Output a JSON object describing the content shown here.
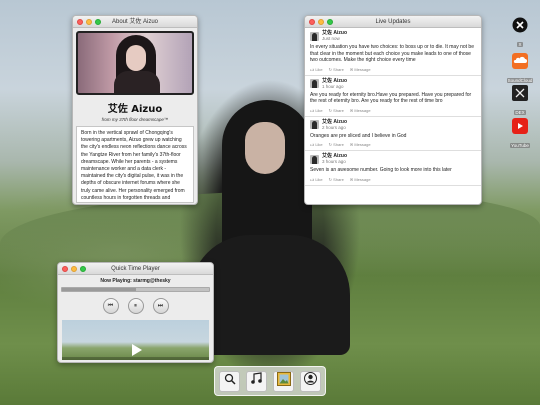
{
  "about": {
    "window_title": "About 艾佐 Aizuo",
    "name": "艾佐 Aizuo",
    "subtitle": "from my 37th floor dreamscape™",
    "bio": "Born in the vertical sprawl of Chongqing's towering apartments, Aizuo grew up watching the city's endless neon reflections dance across the Yangtze River from her family's 37th-floor dreamscape. While her parents - a systems maintenance worker and a data clerk - maintained the city's digital pulse, it was in the depths of obscure internet forums where she truly came alive. Her personality emerged from countless hours in forgotten threads and"
  },
  "live": {
    "window_title": "Live Updates",
    "posts": [
      {
        "user": "艾佐 Aizuo",
        "time": "Just now",
        "text": "In every situation you have two choices: to boss up or to die. It may not be that clear in the moment but each choice you make leads to one of those two outcomes. Make the right choice every time"
      },
      {
        "user": "艾佐 Aizuo",
        "time": "1 hour ago",
        "text": "Are you ready for eternity bro.Have you prepared. Have you prepared for the rest of eternity bro. Are you ready for the rest of time bro"
      },
      {
        "user": "艾佐 Aizuo",
        "time": "2 hours ago",
        "text": "Oranges are pre sliced and I believe in God"
      },
      {
        "user": "艾佐 Aizuo",
        "time": "3 hours ago",
        "text": "Seven is an awesome number. Going to look more into this later"
      }
    ],
    "actions": {
      "like": "Like",
      "share": "Share",
      "message": "Message"
    }
  },
  "player": {
    "window_title": "Quick Time Player",
    "now_playing": "Now Playing: starmg@thesky",
    "progress": 0.5
  },
  "desktop_icons": [
    {
      "label": "X",
      "icon": "x-icon",
      "color": "#111111"
    },
    {
      "label": "SoundCloud",
      "icon": "soundcloud-icon",
      "color": "#f26f23"
    },
    {
      "label": "DEX",
      "icon": "dex-icon",
      "color": "#222222"
    },
    {
      "label": "YouTube",
      "icon": "youtube-icon",
      "color": "#e62117"
    }
  ],
  "dock": [
    {
      "icon": "search-icon"
    },
    {
      "icon": "music-icon"
    },
    {
      "icon": "photo-icon"
    },
    {
      "icon": "user-icon"
    }
  ]
}
